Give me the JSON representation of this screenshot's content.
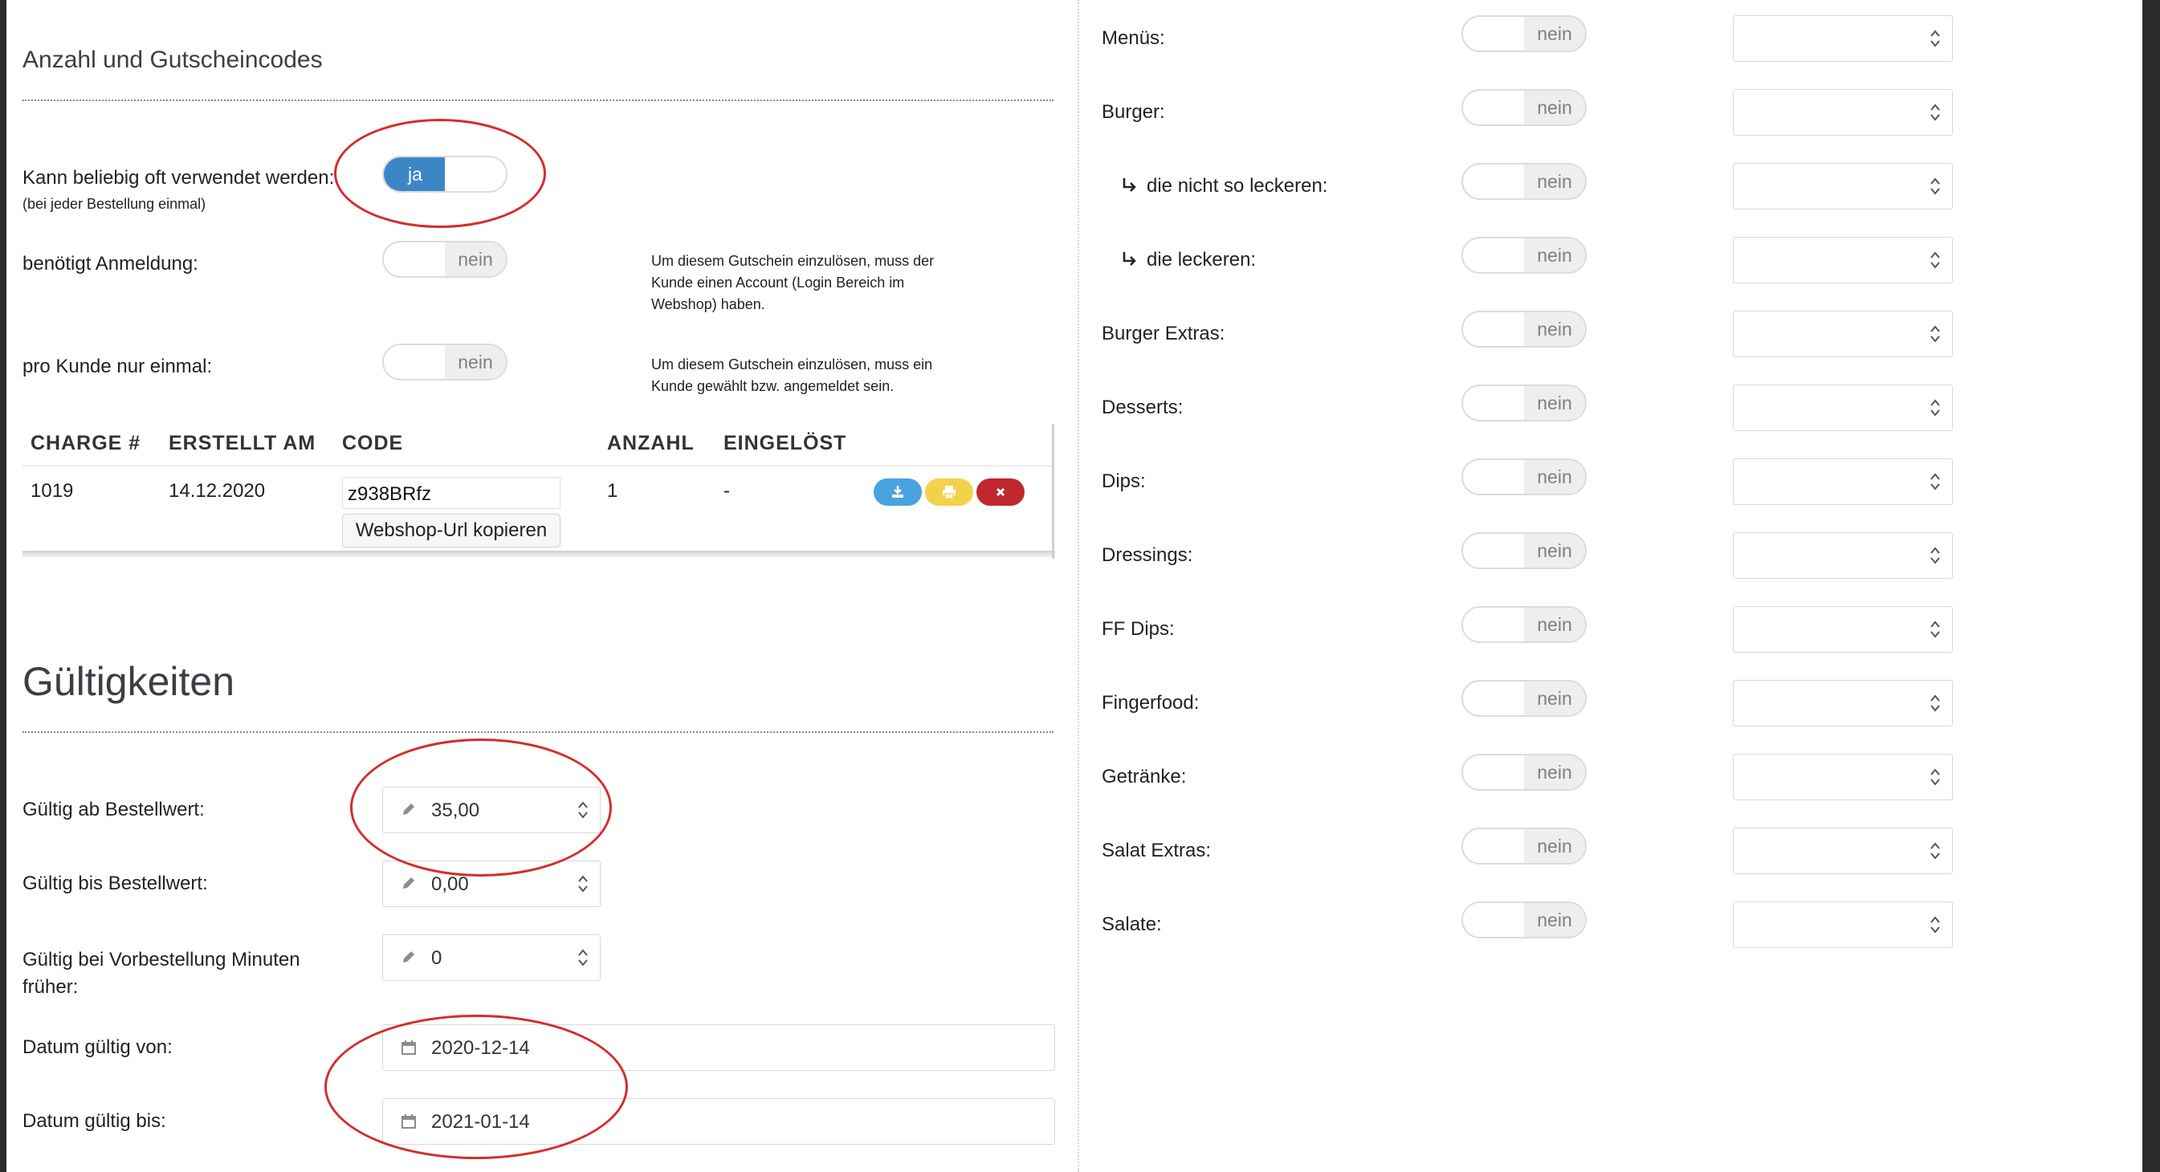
{
  "left": {
    "section1_title": "Anzahl und Gutscheincodes",
    "unlimited": {
      "label": "Kann beliebig oft verwendet werden:",
      "sublabel": "(bei jeder Bestellung einmal)",
      "on_label": "ja"
    },
    "login_required": {
      "label": "benötigt Anmeldung:",
      "value": "nein",
      "note": "Um diesem Gutschein einzulösen, muss der Kunde einen Account (Login Bereich im Webshop) haben."
    },
    "once_per_customer": {
      "label": "pro Kunde nur einmal:",
      "value": "nein",
      "note": "Um diesem Gutschein einzulösen, muss ein Kunde gewählt bzw. angemeldet sein."
    },
    "table": {
      "headers": [
        "CHARGE #",
        "ERSTELLT AM",
        "CODE",
        "ANZAHL",
        "EINGELÖST"
      ],
      "row": {
        "charge": "1019",
        "created": "14.12.2020",
        "code": "z938BRfz",
        "count": "1",
        "redeemed": "-"
      },
      "copy_button": "Webshop-Url kopieren"
    },
    "section2_title": "Gültigkeiten",
    "min_order": {
      "label": "Gültig ab Bestellwert:",
      "value": "35,00"
    },
    "max_order": {
      "label": "Gültig bis Bestellwert:",
      "value": "0,00"
    },
    "preorder_minutes": {
      "label": "Gültig bei Vorbestellung Minuten früher:",
      "value": "0"
    },
    "date_from": {
      "label": "Datum gültig von:",
      "value": "2020-12-14"
    },
    "date_to": {
      "label": "Datum gültig bis:",
      "value": "2021-01-14"
    }
  },
  "categories": [
    {
      "label": "Menüs:",
      "toggle": "nein",
      "sub": false
    },
    {
      "label": "Burger:",
      "toggle": "nein",
      "sub": false
    },
    {
      "label": "die nicht so leckeren:",
      "toggle": "nein",
      "sub": true
    },
    {
      "label": "die leckeren:",
      "toggle": "nein",
      "sub": true
    },
    {
      "label": "Burger Extras:",
      "toggle": "nein",
      "sub": false
    },
    {
      "label": "Desserts:",
      "toggle": "nein",
      "sub": false
    },
    {
      "label": "Dips:",
      "toggle": "nein",
      "sub": false
    },
    {
      "label": "Dressings:",
      "toggle": "nein",
      "sub": false
    },
    {
      "label": "FF Dips:",
      "toggle": "nein",
      "sub": false
    },
    {
      "label": "Fingerfood:",
      "toggle": "nein",
      "sub": false
    },
    {
      "label": "Getränke:",
      "toggle": "nein",
      "sub": false
    },
    {
      "label": "Salat Extras:",
      "toggle": "nein",
      "sub": false
    },
    {
      "label": "Salate:",
      "toggle": "nein",
      "sub": false
    }
  ],
  "colors": {
    "toggle_on": "#3d86c6",
    "download_button": "#4aa3df",
    "print_button": "#f3d24b",
    "delete_button": "#c0282d",
    "annotation": "#d62c2c"
  },
  "icons": {
    "download": "download-icon",
    "print": "print-icon",
    "delete": "close-icon",
    "pencil": "pencil-icon",
    "calendar": "calendar-icon",
    "subcategory": "corner-arrow-icon"
  }
}
